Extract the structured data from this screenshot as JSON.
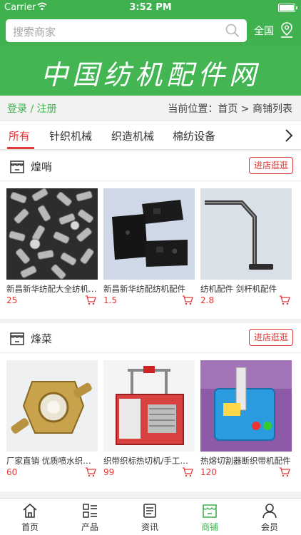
{
  "status_bar": {
    "carrier": "Carrier",
    "time": "3:52 PM"
  },
  "header": {
    "search_placeholder": "搜索商家",
    "city": "全国"
  },
  "banner": {
    "title": "中国纺机配件网"
  },
  "crumb": {
    "login": "登录 / 注册",
    "location": "当前位置：首页 > 商铺列表"
  },
  "tabs": [
    {
      "label": "所有",
      "active": true
    },
    {
      "label": "针织机械"
    },
    {
      "label": "织造机械"
    },
    {
      "label": "棉纺设备"
    }
  ],
  "shops": [
    {
      "name": "煌哨",
      "button": "进店逛逛",
      "products": [
        {
          "name": "新昌新华纺配大全纺机配件",
          "price": "25"
        },
        {
          "name": "新昌新华纺配纺机配件",
          "price": "1.5"
        },
        {
          "name": "纺机配件 剑杆机配件",
          "price": "2.8"
        }
      ]
    },
    {
      "name": "烽菜",
      "button": "进店逛逛",
      "products": [
        {
          "name": "厂家直销 优质喷水织机配件",
          "price": "60"
        },
        {
          "name": "织带织标热切机/手工切带机",
          "price": "99"
        },
        {
          "name": "热熔切割器断织带机配件",
          "price": "120"
        }
      ]
    }
  ],
  "tabbar": [
    {
      "label": "首页",
      "icon": "home-icon"
    },
    {
      "label": "产品",
      "icon": "list-icon"
    },
    {
      "label": "资讯",
      "icon": "news-icon"
    },
    {
      "label": "商铺",
      "icon": "store-icon",
      "active": true
    },
    {
      "label": "会员",
      "icon": "user-icon"
    }
  ],
  "colors": {
    "brand_green": "#3fb24f",
    "accent_red": "#e03b3b"
  }
}
